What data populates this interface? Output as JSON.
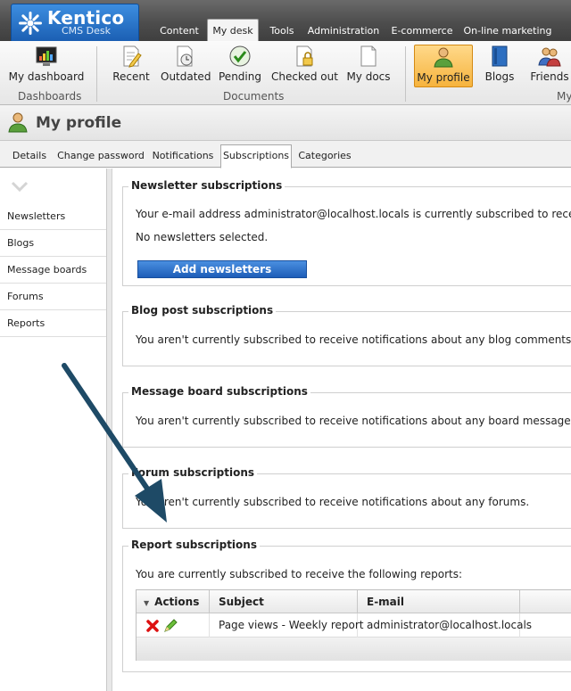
{
  "app": {
    "brand": "Kentico",
    "product": "CMS Desk"
  },
  "main_tabs": [
    "Content",
    "My desk",
    "Tools",
    "Administration",
    "E-commerce",
    "On-line marketing"
  ],
  "ribbon": {
    "groups": {
      "dashboards": "Dashboards",
      "documents": "Documents",
      "my": "My"
    },
    "buttons": {
      "my_dashboard": "My dashboard",
      "recent": "Recent",
      "outdated": "Outdated",
      "pending": "Pending",
      "checked_out": "Checked out",
      "my_docs": "My docs",
      "my_profile": "My profile",
      "blogs": "Blogs",
      "friends": "Friends"
    }
  },
  "page": {
    "title": "My profile"
  },
  "sub_tabs": [
    "Details",
    "Change password",
    "Notifications",
    "Subscriptions",
    "Categories"
  ],
  "left_menu": [
    "Newsletters",
    "Blogs",
    "Message boards",
    "Forums",
    "Reports"
  ],
  "sections": {
    "newsletter": {
      "title": "Newsletter subscriptions",
      "text": "Your e-mail address administrator@localhost.locals is currently subscribed to receive the foll",
      "none": "No newsletters selected.",
      "button": "Add newsletters"
    },
    "blog": {
      "title": "Blog post subscriptions",
      "text": "You aren't currently subscribed to receive notifications about any blog comments."
    },
    "board": {
      "title": "Message board subscriptions",
      "text": "You aren't currently subscribed to receive notifications about any board messages."
    },
    "forum": {
      "title": "Forum subscriptions",
      "text": "You aren't currently subscribed to receive notifications about any forums."
    },
    "report": {
      "title": "Report subscriptions",
      "text": "You are currently subscribed to receive the following reports:",
      "columns": {
        "actions": "Actions",
        "subject": "Subject",
        "email": "E-mail"
      },
      "rows": [
        {
          "subject": "Page views - Weekly report",
          "email": "administrator@localhost.locals"
        }
      ]
    }
  },
  "colors": {
    "accent_blue": "#1d5db8",
    "selected_orange": "#f6b33d",
    "arrow": "#1e4a66"
  }
}
